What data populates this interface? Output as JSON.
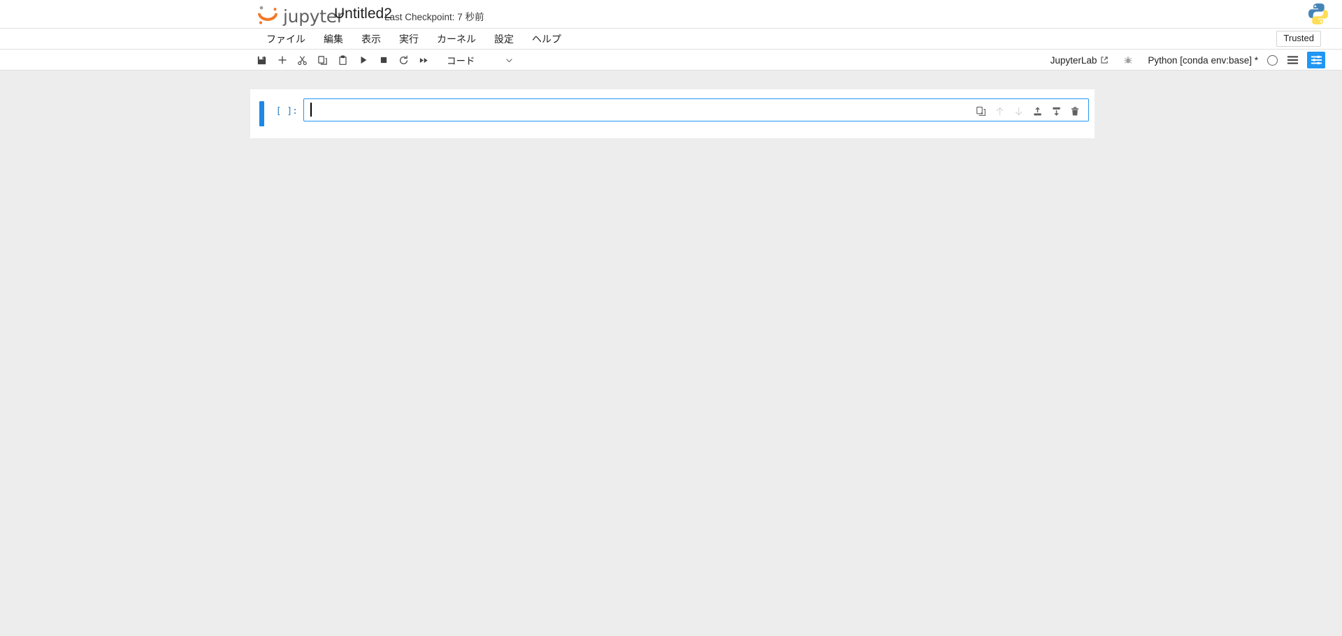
{
  "header": {
    "brand_word": "jupyter",
    "brand_logo_icon": "jupyter-logo-icon",
    "notebook_title": "Untitled2",
    "checkpoint_text": "Last Checkpoint: 7 秒前",
    "python_logo_icon": "python-logo-icon"
  },
  "menubar": {
    "items": [
      {
        "label": "ファイル",
        "name": "menu-file"
      },
      {
        "label": "編集",
        "name": "menu-edit"
      },
      {
        "label": "表示",
        "name": "menu-view"
      },
      {
        "label": "実行",
        "name": "menu-run"
      },
      {
        "label": "カーネル",
        "name": "menu-kernel"
      },
      {
        "label": "設定",
        "name": "menu-settings"
      },
      {
        "label": "ヘルプ",
        "name": "menu-help"
      }
    ],
    "trusted_label": "Trusted"
  },
  "toolbar": {
    "buttons": [
      {
        "name": "save-button",
        "icon": "save-icon",
        "title": "保存"
      },
      {
        "name": "insert-cell-button",
        "icon": "plus-icon",
        "title": "セルを挿入"
      },
      {
        "name": "cut-cell-button",
        "icon": "scissors-icon",
        "title": "切り取り"
      },
      {
        "name": "copy-cell-button",
        "icon": "copy-icon",
        "title": "コピー"
      },
      {
        "name": "paste-cell-button",
        "icon": "clipboard-icon",
        "title": "貼り付け"
      },
      {
        "name": "run-cell-button",
        "icon": "play-icon",
        "title": "実行"
      },
      {
        "name": "stop-kernel-button",
        "icon": "stop-square-icon",
        "title": "停止"
      },
      {
        "name": "restart-kernel-button",
        "icon": "restart-circle-icon",
        "title": "再起動"
      },
      {
        "name": "restart-run-all-button",
        "icon": "fast-forward-icon",
        "title": "すべて実行"
      }
    ],
    "cell_type_value": "コード",
    "cell_type_chevron_icon": "chevron-down-icon",
    "jupyterlab_label": "JupyterLab",
    "jupyterlab_external_icon": "external-link-icon",
    "debugger_icon": "bug-icon",
    "kernel_label": "Python [conda env:base] *",
    "kernel_status_icon": "kernel-idle-circle-icon",
    "toggle_list_icon": "lines-list-icon",
    "toggle_panel_icon": "sliders-panel-icon"
  },
  "notebook": {
    "cell": {
      "prompt": "[ ]:",
      "code_value": "",
      "tools": [
        {
          "name": "duplicate-cell-button",
          "icon": "duplicate-icon",
          "disabled": false
        },
        {
          "name": "move-cell-up-button",
          "icon": "arrow-up-icon",
          "disabled": true
        },
        {
          "name": "move-cell-down-button",
          "icon": "arrow-down-icon",
          "disabled": true
        },
        {
          "name": "insert-cell-above-button",
          "icon": "insert-above-icon",
          "disabled": false
        },
        {
          "name": "insert-cell-below-button",
          "icon": "insert-below-icon",
          "disabled": false
        },
        {
          "name": "delete-cell-button",
          "icon": "trash-icon",
          "disabled": false
        }
      ]
    }
  },
  "colors": {
    "accent_blue": "#2196f3",
    "active_cell_bar": "#1e88e5",
    "page_background": "#ededed",
    "panel_background": "#ffffff",
    "prompt_blue": "#307fc1",
    "jupyter_orange": "#f37726"
  }
}
